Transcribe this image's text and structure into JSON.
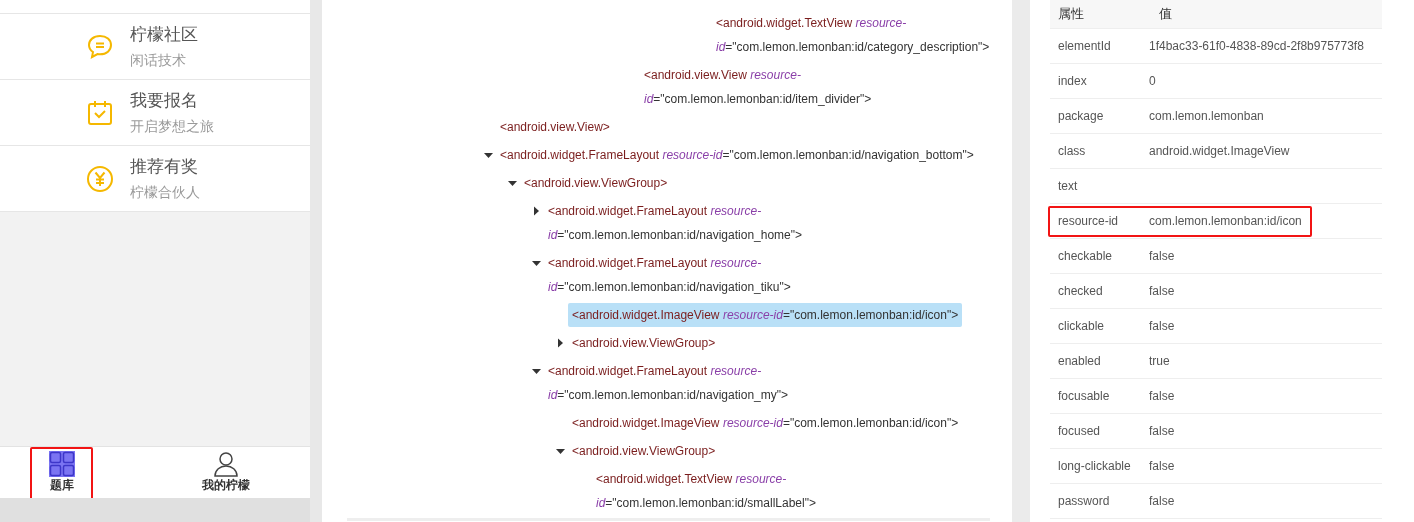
{
  "app_preview": {
    "menu_items": [
      {
        "kind": "chat",
        "title": "柠檬社区",
        "subtitle": "闲话技术"
      },
      {
        "kind": "calendar",
        "title": "我要报名",
        "subtitle": "开启梦想之旅"
      },
      {
        "kind": "yen",
        "title": "推荐有奖",
        "subtitle": "柠檬合伙人"
      }
    ],
    "tabs": [
      {
        "kind": "grid",
        "label": "题库",
        "selected": true,
        "highlighted": true
      },
      {
        "kind": "person",
        "label": "我的柠檬",
        "selected": false,
        "highlighted": false
      }
    ]
  },
  "tree": {
    "nodes": [
      {
        "children": [
          {
            "children": [
              {
                "children": [
                  {
                    "children": [
                      {
                        "children": [
                          {
                            "children": [
                              {
                                "children": [
                                  {
                                    "children": [
                                      {
                                        "children": [
                                          {
                                            "open": "<android.widget.TextView",
                                            "attr": "resource-id",
                                            "value": "=\"com.lemon.lemonban:id/category_description\">",
                                            "selected": false
                                          }
                                        ]
                                      }
                                    ]
                                  }
                                ]
                              },
                              {
                                "open": "<android.view.View",
                                "attr": "resource-id",
                                "value": "=\"com.lemon.lemonban:id/item_divider\">",
                                "selected": false
                              }
                            ]
                          }
                        ]
                      }
                    ]
                  }
                ]
              }
            ]
          }
        ]
      },
      {
        "open": "<android.view.View>",
        "selected": false
      },
      {
        "open": "<android.widget.FrameLayout",
        "attr": "resource-id",
        "value": "=\"com.lemon.lemonban:id/navigation_bottom\">",
        "selected": false,
        "expanded": true,
        "children": [
          {
            "open": "<android.view.ViewGroup>",
            "selected": false,
            "expanded": true,
            "children": [
              {
                "open": "<android.widget.FrameLayout",
                "attr": "resource-id",
                "value": "=\"com.lemon.lemonban:id/navigation_home\">",
                "selected": false,
                "expanded": false
              },
              {
                "open": "<android.widget.FrameLayout",
                "attr": "resource-id",
                "value": "=\"com.lemon.lemonban:id/navigation_tiku\">",
                "selected": false,
                "expanded": true,
                "children": [
                  {
                    "open": "<android.widget.ImageView",
                    "attr": "resource-id",
                    "value": "=\"com.lemon.lemonban:id/icon\">",
                    "selected": true
                  },
                  {
                    "open": "<android.view.ViewGroup>",
                    "selected": false,
                    "expanded": false
                  }
                ]
              },
              {
                "open": "<android.widget.FrameLayout",
                "attr": "resource-id",
                "value": "=\"com.lemon.lemonban:id/navigation_my\">",
                "selected": false,
                "expanded": true,
                "children": [
                  {
                    "open": "<android.widget.ImageView",
                    "attr": "resource-id",
                    "value": "=\"com.lemon.lemonban:id/icon\">",
                    "selected": false
                  },
                  {
                    "open": "<android.view.ViewGroup>",
                    "selected": false,
                    "expanded": true,
                    "children": [
                      {
                        "open": "<android.widget.TextView",
                        "attr": "resource-id",
                        "value": "=\"com.lemon.lemonban:id/smallLabel\">",
                        "selected": false
                      }
                    ]
                  }
                ]
              }
            ]
          }
        ]
      }
    ]
  },
  "properties": {
    "columns": [
      "属性",
      "值"
    ],
    "rows": [
      {
        "name": "elementId",
        "value": "1f4bac33-61f0-4838-89cd-2f8b975773f8",
        "highlighted": false
      },
      {
        "name": "index",
        "value": "0",
        "highlighted": false
      },
      {
        "name": "package",
        "value": "com.lemon.lemonban",
        "highlighted": false
      },
      {
        "name": "class",
        "value": "android.widget.ImageView",
        "highlighted": false
      },
      {
        "name": "text",
        "highlighted": false
      },
      {
        "name": "resource-id",
        "value": "com.lemon.lemonban:id/icon",
        "highlighted": true
      },
      {
        "name": "checkable",
        "value": "false",
        "highlighted": false
      },
      {
        "name": "checked",
        "value": "false",
        "highlighted": false
      },
      {
        "name": "clickable",
        "value": "false",
        "highlighted": false
      },
      {
        "name": "enabled",
        "value": "true",
        "highlighted": false
      },
      {
        "name": "focusable",
        "value": "false",
        "highlighted": false
      },
      {
        "name": "focused",
        "value": "false",
        "highlighted": false
      },
      {
        "name": "long-clickable",
        "value": "false",
        "highlighted": false
      },
      {
        "name": "password",
        "value": "false",
        "highlighted": false
      }
    ]
  }
}
